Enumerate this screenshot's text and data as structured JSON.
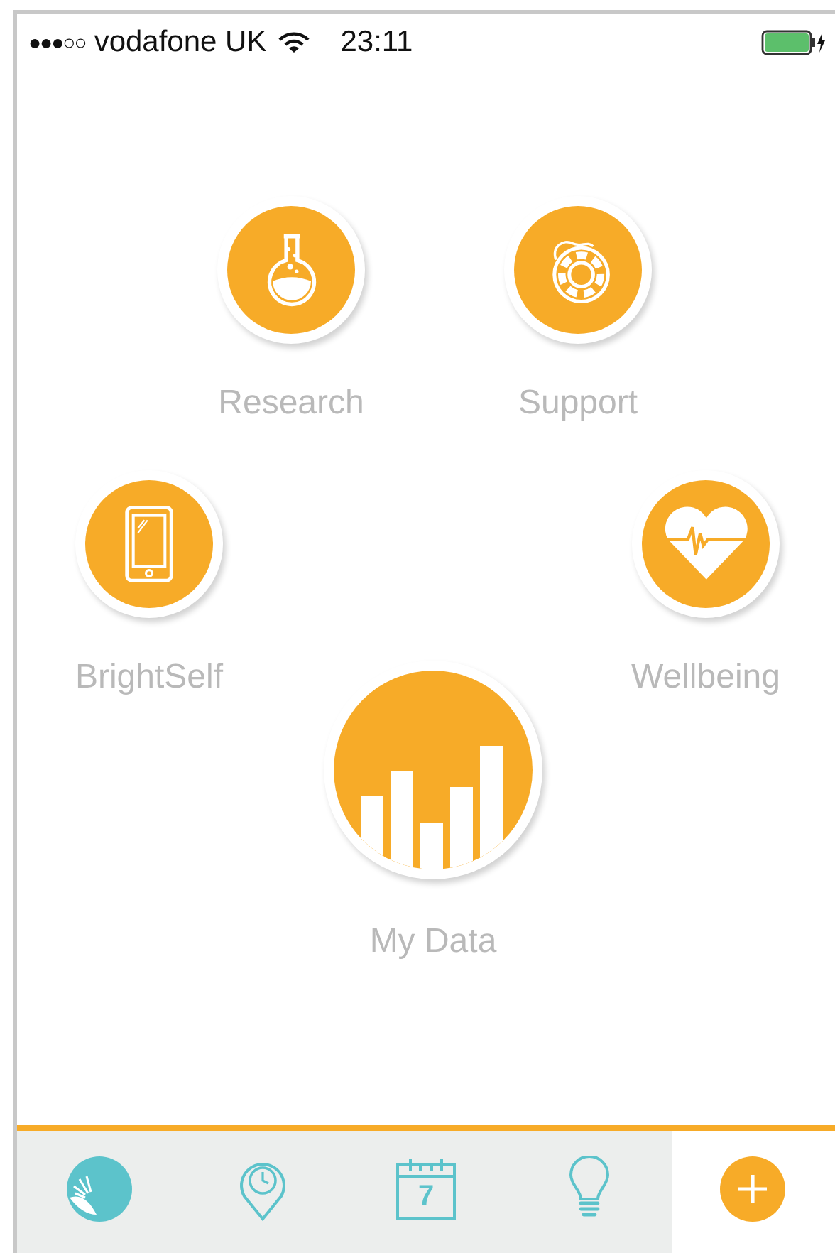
{
  "status_bar": {
    "signal": "●●●○○",
    "carrier": "vodafone UK",
    "time": "23:11",
    "charging": true
  },
  "menu": [
    {
      "label": "Research",
      "kind": "flask"
    },
    {
      "label": "Support",
      "kind": "lifebuoy"
    },
    {
      "label": "BrightSelf",
      "kind": "phone"
    },
    {
      "label": "Wellbeing",
      "kind": "heart"
    },
    {
      "label": "My Data",
      "kind": "chart"
    }
  ],
  "tabs": [
    {
      "kind": "home",
      "selected": false
    },
    {
      "kind": "location",
      "selected": false
    },
    {
      "kind": "calendar",
      "selected": false,
      "text": "7"
    },
    {
      "kind": "tip",
      "selected": false
    },
    {
      "kind": "add",
      "selected": true
    }
  ]
}
